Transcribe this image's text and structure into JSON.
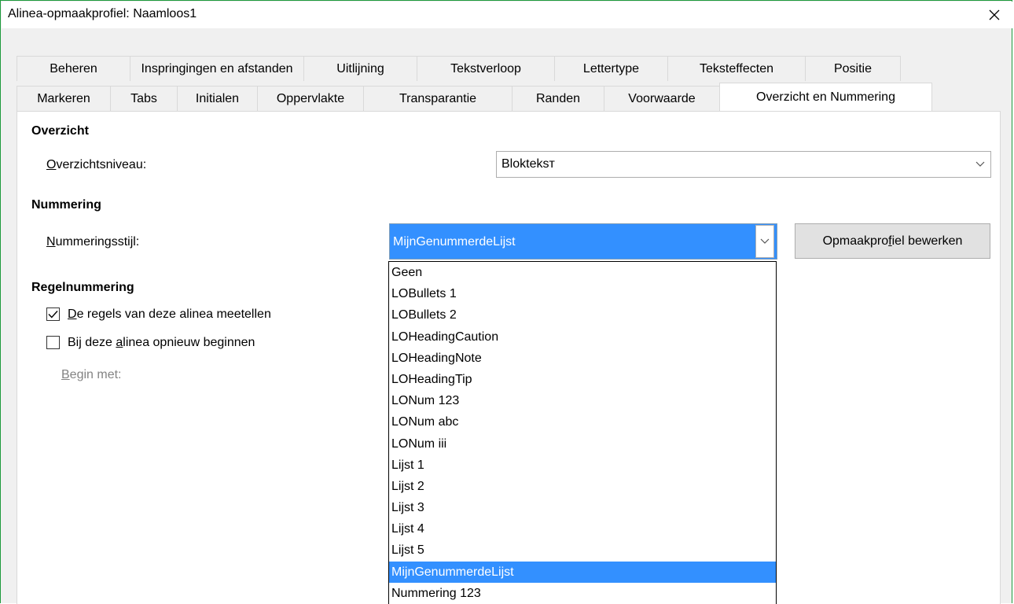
{
  "window": {
    "title": "Alinea-opmaakprofiel: Naamloos1",
    "close_icon": "close-icon"
  },
  "tabs": {
    "row1": [
      "Beheren",
      "Inspringingen en afstanden",
      "Uitlijning",
      "Tekstverloop",
      "Lettertype",
      "Teksteffecten",
      "Positie"
    ],
    "row2": [
      "Markeren",
      "Tabs",
      "Initialen",
      "Oppervlakte",
      "Transparantie",
      "Randen",
      "Voorwaarde",
      "Overzicht en Nummering"
    ],
    "active": "Overzicht en Nummering"
  },
  "outline": {
    "heading": "Overzicht",
    "level_label_prefix": "",
    "level_label_mnemonic": "O",
    "level_label_rest": "verzichtsniveau:",
    "level_value": "Blokteksт"
  },
  "numbering": {
    "heading": "Nummering",
    "style_label_mnemonic": "N",
    "style_label_rest": "ummeringsstijl:",
    "style_value": "MijnGenummerdeLijst",
    "edit_button_pre": "Opmaakpro",
    "edit_button_mnemonic": "f",
    "edit_button_post": "iel bewerken",
    "options": [
      "Geen",
      "LOBullets 1",
      "LOBullets 2",
      "LOHeadingCaution",
      "LOHeadingNote",
      "LOHeadingTip",
      "LONum 123",
      "LONum abc",
      "LONum iii",
      "Lijst 1",
      "Lijst 2",
      "Lijst 3",
      "Lijst 4",
      "Lijst 5",
      "MijnGenummerdeLijst",
      "Nummering 123"
    ],
    "selected_option": "MijnGenummerdeLijst"
  },
  "line_numbering": {
    "heading": "Regelnummering",
    "count_lines": {
      "mnemonic": "D",
      "rest": "e regels van deze alinea meetellen",
      "checked": true
    },
    "restart": {
      "pre": "Bij deze ",
      "mnemonic": "a",
      "post": "linea opnieuw beginnen",
      "checked": false
    },
    "start_with_mnemonic": "B",
    "start_with_rest": "egin met:"
  },
  "colors": {
    "selection": "#3390ff",
    "window_border": "#1e9a3c"
  }
}
